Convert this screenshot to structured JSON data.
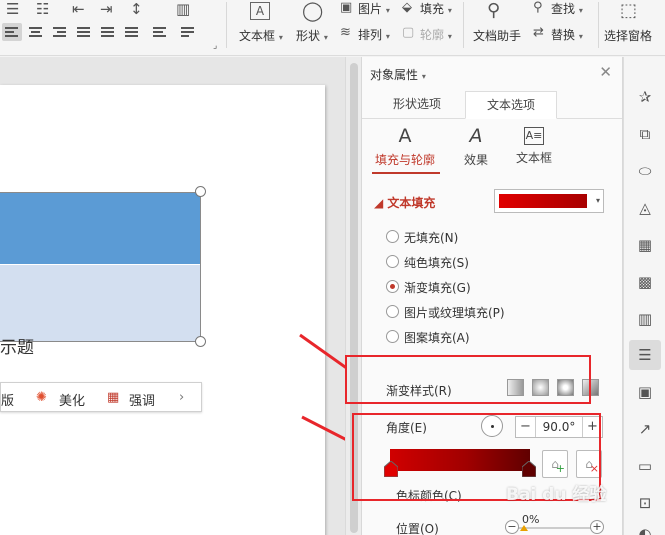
{
  "ribbon": {
    "groups": [
      {
        "label": "文本框"
      },
      {
        "label": "形状"
      },
      {
        "label": "图片"
      },
      {
        "label": "填充"
      },
      {
        "label": "排列"
      },
      {
        "label": "轮廓"
      },
      {
        "label": "文档助手"
      },
      {
        "label": "查找"
      },
      {
        "label": "替换"
      },
      {
        "label": "选择窗格"
      }
    ]
  },
  "slide": {
    "title_fragment": "示题",
    "float_bar": [
      {
        "label": "版",
        "icon": "layout-icon"
      },
      {
        "label": "美化",
        "icon": "sparkle-icon"
      },
      {
        "label": "强调",
        "icon": "table-icon"
      }
    ]
  },
  "panel": {
    "title": "对象属性",
    "tabs": [
      "形状选项",
      "文本选项"
    ],
    "active_tab": "文本选项",
    "subtabs": [
      "填充与轮廓",
      "效果",
      "文本框"
    ],
    "active_subtab": "填充与轮廓",
    "section": "文本填充",
    "fill_options": [
      {
        "label": "无填充(N)",
        "checked": false
      },
      {
        "label": "纯色填充(S)",
        "checked": false
      },
      {
        "label": "渐变填充(G)",
        "checked": true
      },
      {
        "label": "图片或纹理填充(P)",
        "checked": false
      },
      {
        "label": "图案填充(A)",
        "checked": false
      }
    ],
    "gradient_style_label": "渐变样式(R)",
    "angle_label": "角度(E)",
    "angle_value": "90.0°",
    "stop_color_label": "色标颜色(C)",
    "position_label": "位置(O)",
    "position_value": "0%"
  },
  "colors": {
    "accent": "#c0392b",
    "annotation": "#e8262b",
    "shape_blue": "#5b9bd5",
    "shape_light": "#d3dff0"
  },
  "watermark": "Bai du 经验"
}
